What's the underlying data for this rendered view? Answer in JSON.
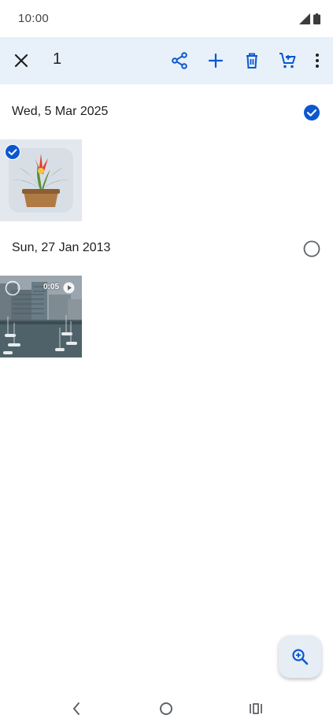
{
  "status_bar": {
    "time": "10:00"
  },
  "selection_bar": {
    "count": "1"
  },
  "groups": [
    {
      "date": "Wed, 5 Mar 2025",
      "selected": true
    },
    {
      "date": "Sun, 27 Jan 2013",
      "selected": false,
      "video_duration": "0:05"
    }
  ],
  "colors": {
    "accent": "#0b57d0",
    "toolbar_bg": "#e8f0f9",
    "fab_bg": "#e6edf5"
  }
}
